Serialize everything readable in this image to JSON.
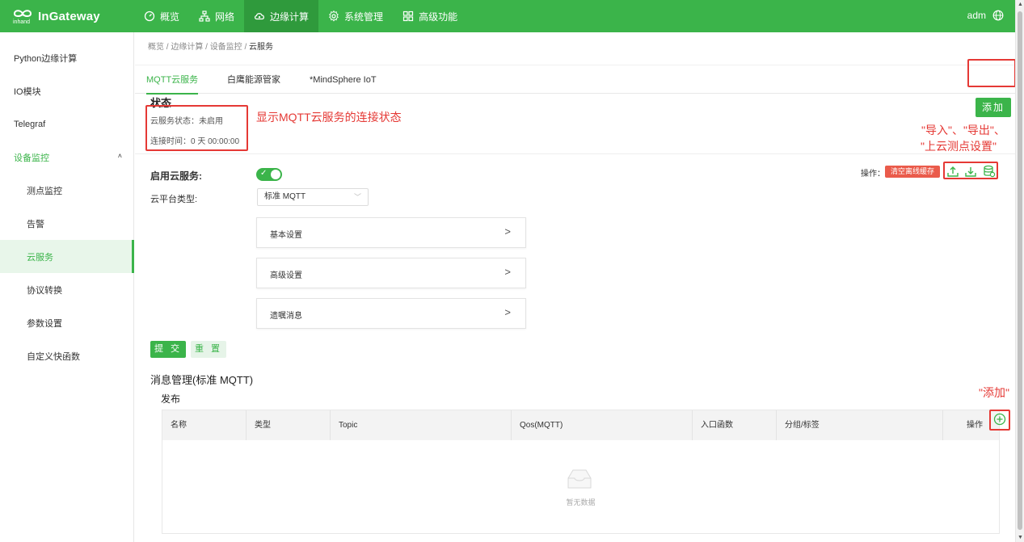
{
  "brand": {
    "name": "InGateway",
    "sub": "inhand"
  },
  "topnav": {
    "items": [
      {
        "label": "概览",
        "icon": "dashboard-icon"
      },
      {
        "label": "网络",
        "icon": "network-icon"
      },
      {
        "label": "边缘计算",
        "icon": "cloud-icon",
        "active": true
      },
      {
        "label": "系统管理",
        "icon": "gear-icon"
      },
      {
        "label": "高级功能",
        "icon": "grid-icon"
      }
    ],
    "user": "adm"
  },
  "sidebar": {
    "items": [
      {
        "label": "Python边缘计算"
      },
      {
        "label": "IO模块"
      },
      {
        "label": "Telegraf"
      },
      {
        "label": "设备监控",
        "group": true,
        "caret": "˄"
      },
      {
        "label": "测点监控"
      },
      {
        "label": "告警"
      },
      {
        "label": "云服务",
        "active": true
      },
      {
        "label": "协议转换"
      },
      {
        "label": "参数设置"
      },
      {
        "label": "自定义快函数"
      }
    ]
  },
  "breadcrumb": {
    "items": [
      "概览",
      "边缘计算",
      "设备监控"
    ],
    "sep": " / ",
    "current": "云服务"
  },
  "tabs": [
    {
      "label": "MQTT云服务",
      "active": true
    },
    {
      "label": "白鹰能源管家"
    },
    {
      "label": "*MindSphere IoT"
    }
  ],
  "add_button": "添加",
  "status": {
    "title": "状态",
    "service_status": "云服务状态：未启用",
    "connect_time": "连接时间：0 天 00:00:00"
  },
  "form": {
    "enable_label": "启用云服务:",
    "enabled": true,
    "platform_label": "云平台类型:",
    "platform_value": "标准 MQTT",
    "panels": [
      "基本设置",
      "高级设置",
      "遗嘱消息"
    ],
    "panel_arrow": ">",
    "submit": "提 交",
    "reset": "重 置"
  },
  "operations": {
    "label": "操作：",
    "clear_button": "清空离线缓存"
  },
  "messages": {
    "title": "消息管理(标准 MQTT)",
    "publish_title": "发布",
    "columns": [
      "名称",
      "类型",
      "Topic",
      "Qos(MQTT)",
      "入口函数",
      "分组/标签",
      "操作"
    ],
    "empty_text": "暂无数据"
  },
  "annotations": {
    "status_note": "显示MQTT云服务的连接状态",
    "ops_note_line1": "\"导入\"、\"导出\"、",
    "ops_note_line2": "\"上云测点设置\"",
    "add_note": "\"添加\""
  },
  "colors": {
    "primary": "#3bb44a",
    "danger": "#ea5b4b",
    "annotation": "#e53935"
  }
}
